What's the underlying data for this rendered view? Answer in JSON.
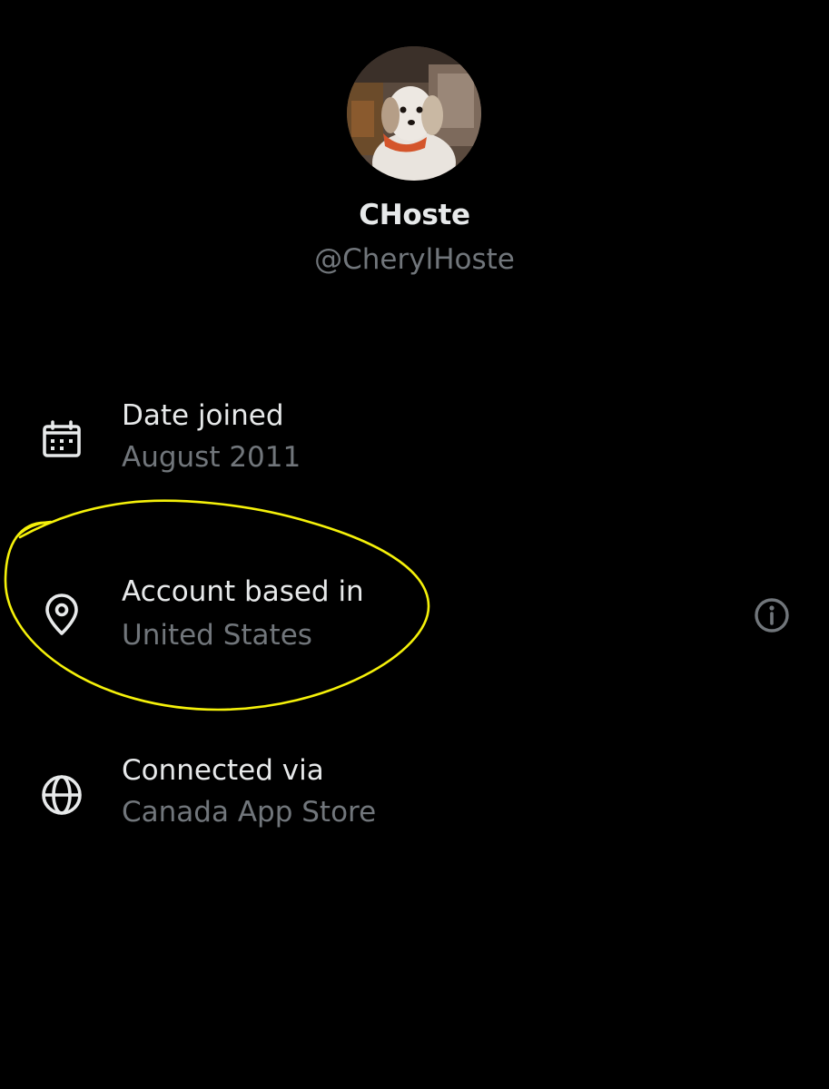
{
  "profile": {
    "display_name": "CHoste",
    "handle": "@CherylHoste",
    "avatar_icon": "dog-photo-avatar"
  },
  "about": {
    "rows": [
      {
        "icon": "calendar-icon",
        "label": "Date joined",
        "value": "August 2011"
      },
      {
        "icon": "location-pin-icon",
        "label": "Account based in",
        "value": "United States",
        "info_icon": "info-icon"
      },
      {
        "icon": "globe-icon",
        "label": "Connected via",
        "value": "Canada App Store"
      }
    ]
  },
  "colors": {
    "background": "#000000",
    "primary_text": "#e7e9ea",
    "secondary_text": "#71767b",
    "highlight_annotation": "#f5f10a"
  }
}
